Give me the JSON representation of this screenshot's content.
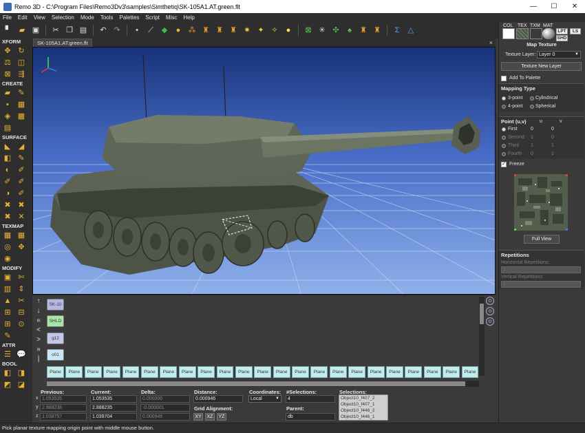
{
  "window": {
    "title": "Remo 3D - C:\\Program Files\\Remo3Dv3\\samples\\Simthetiq\\SK-105A1.AT.green.flt",
    "minimize": "—",
    "maximize": "☐",
    "close": "✕"
  },
  "menu": [
    "File",
    "Edit",
    "View",
    "Selection",
    "Mode",
    "Tools",
    "Palettes",
    "Script",
    "Misc",
    "Help"
  ],
  "toolbar_icons": [
    {
      "name": "new-icon",
      "glyph": "▘",
      "color": "#e8e8e8"
    },
    {
      "name": "open-icon",
      "glyph": "▰",
      "color": "#e8c048"
    },
    {
      "name": "save-icon",
      "glyph": "▣",
      "color": "#dddddd"
    },
    {
      "name": "cut-icon",
      "glyph": "✂",
      "color": "#dddddd"
    },
    {
      "name": "copy-icon",
      "glyph": "❐",
      "color": "#dddddd"
    },
    {
      "name": "paste-icon",
      "glyph": "▤",
      "color": "#dddddd"
    },
    {
      "name": "undo-icon",
      "glyph": "↶",
      "color": "#dddddd"
    },
    {
      "name": "redo-icon",
      "glyph": "↷",
      "color": "#9a9a9a"
    },
    {
      "name": "select-vertex-icon",
      "glyph": "•",
      "color": "#dddddd"
    },
    {
      "name": "select-edge-icon",
      "glyph": "⟋",
      "color": "#dddddd"
    },
    {
      "name": "select-face-icon",
      "glyph": "◆",
      "color": "#44b84a"
    },
    {
      "name": "select-object-icon",
      "glyph": "●",
      "color": "#e8b030"
    },
    {
      "name": "select-group-icon",
      "glyph": "⁂",
      "color": "#e89030"
    },
    {
      "name": "hierarchy-icon",
      "glyph": "♜",
      "color": "#e89030"
    },
    {
      "name": "lod-icon",
      "glyph": "♜",
      "color": "#e8a030"
    },
    {
      "name": "switch-icon",
      "glyph": "♜",
      "color": "#e8a030"
    },
    {
      "name": "light-point-icon",
      "glyph": "✷",
      "color": "#f0d040"
    },
    {
      "name": "light-points-icon",
      "glyph": "✦",
      "color": "#f0d040"
    },
    {
      "name": "light-string-icon",
      "glyph": "✧",
      "color": "#f0d040"
    },
    {
      "name": "light-source-icon",
      "glyph": "●",
      "color": "#f5e050"
    },
    {
      "name": "dof-icon",
      "glyph": "⊠",
      "color": "#5cc85c"
    },
    {
      "name": "clip-icon",
      "glyph": "✳",
      "color": "#dddddd"
    },
    {
      "name": "degree-of-freedom-icon",
      "glyph": "✣",
      "color": "#5cc85c"
    },
    {
      "name": "sound-icon",
      "glyph": "♠",
      "color": "#5cc85c"
    },
    {
      "name": "texture-mapping-icon",
      "glyph": "♜",
      "color": "#e8a030"
    },
    {
      "name": "transform-icon",
      "glyph": "♜",
      "color": "#e8a030"
    },
    {
      "name": "sum-icon",
      "glyph": "Σ",
      "color": "#58a0e8"
    },
    {
      "name": "triangle-icon",
      "glyph": "△",
      "color": "#58a0e8"
    }
  ],
  "left_tools": [
    {
      "label": "XFORM",
      "rows": [
        [
          "✥",
          "↻"
        ],
        [
          "⚖",
          "◫"
        ],
        [
          "⊠",
          "⇶"
        ]
      ]
    },
    {
      "label": "CREATE",
      "rows": [
        [
          "▰",
          "✎"
        ],
        [
          "▪",
          "▦"
        ],
        [
          "◈",
          "▩"
        ],
        [
          "▤",
          ""
        ]
      ]
    },
    {
      "label": "SURFACE",
      "rows": [
        [
          "◣",
          "◢"
        ],
        [
          "◧",
          "✎"
        ],
        [
          "◐",
          "✐"
        ],
        [
          "✐",
          "✐"
        ],
        [
          "◑",
          "✐"
        ],
        [
          "✖",
          "✖"
        ],
        [
          "✖",
          "✕"
        ]
      ]
    },
    {
      "label": "TEXMAP",
      "rows": [
        [
          "▦",
          "▦"
        ],
        [
          "◎",
          "✥"
        ],
        [
          "◉",
          ""
        ]
      ]
    },
    {
      "label": "MODIFY",
      "rows": [
        [
          "▣",
          "✄"
        ],
        [
          "▥",
          "⇕"
        ],
        [
          "▲",
          "✂"
        ],
        [
          "⊞",
          "⊟"
        ],
        [
          "⊞",
          "⊙"
        ],
        [
          "✎",
          ""
        ]
      ]
    },
    {
      "label": "ATTR",
      "rows": [
        [
          "☰",
          "💬"
        ]
      ]
    },
    {
      "label": "BOOL",
      "rows": [
        [
          "◧",
          "◨"
        ],
        [
          "◩",
          "◪"
        ]
      ]
    }
  ],
  "document_tab": "SK-105A1.AT.green.flt",
  "document_tab_close": "×",
  "viewport": {
    "axis_x_color": "#e63c3c",
    "axis_y_color": "#3c78e6",
    "axis_z_color": "#3ce63c"
  },
  "scenegraph": {
    "arrows": [
      "↑",
      "↓",
      "«",
      "<",
      ">",
      "»",
      "|"
    ],
    "nodes": [
      {
        "label": "SK-10",
        "color": "#b7b7e6"
      },
      {
        "label": "SHLD",
        "color": "#a7e5a7"
      },
      {
        "label": "g12",
        "color": "#c5c5ea"
      },
      {
        "label": "o01",
        "color": "#c8e8f8"
      }
    ],
    "leaves": [
      "Plane",
      "Plane",
      "Plane",
      "Plane",
      "Plane",
      "Plane",
      "Plane",
      "Plane",
      "Plane",
      "Plane",
      "Plane",
      "Plane",
      "Plane",
      "Plane",
      "Plane",
      "Plane",
      "Plane",
      "Plane",
      "Plane",
      "Plane",
      "Plane",
      "Plane",
      "Plane"
    ],
    "side_buttons": [
      "⊙",
      "⊙",
      "⊙"
    ]
  },
  "info": {
    "previous_label": "Previous:",
    "current_label": "Current:",
    "delta_label": "Delta:",
    "distance_label": "Distance:",
    "coordinates_label": "Coordinates:",
    "selections_count_label": "#Selections:",
    "selections_label": "Selections:",
    "grid_alignment_label": "Grid Alignment:",
    "parent_label": "Parent:",
    "axes": [
      "x",
      "y",
      "z"
    ],
    "previous": [
      "1.053535",
      "2.888236",
      "1.038757"
    ],
    "current": [
      "1.053535",
      "2.888235",
      "1.039704"
    ],
    "delta": [
      "0.000000",
      "-0.000001",
      "0.000946"
    ],
    "distance": "0.000946",
    "coordinates": "Local",
    "selections_count": "4",
    "parent": "db",
    "grid_buttons": [
      "XY",
      "XZ",
      "YZ"
    ],
    "selections": [
      "Object10_f407_2",
      "Object10_f407_1",
      "Object10_f446_2",
      "Object10_f446_1"
    ]
  },
  "status": "Pick planar texture mapping origin point with middle mouse button.",
  "right_panel": {
    "tabs": [
      "COL",
      "TEX",
      "TXM",
      "MAT"
    ],
    "small_buttons": [
      "LPT",
      "LS",
      "SHD"
    ],
    "title": "Map Texture",
    "texture_layer_label": "Texture Layer:",
    "texture_layer_value": "Layer 0",
    "texture_new_layer": "Texture New Layer",
    "add_to_palette": "Add To Palette",
    "mapping_type_title": "Mapping Type",
    "mapping_types": [
      "3-point",
      "Cylindrical",
      "4-point",
      "Spherical"
    ],
    "point_title": "Point (u,v)",
    "u_label": "u",
    "v_label": "v",
    "points": [
      {
        "name": "First",
        "u": "0",
        "v": "0",
        "active": true
      },
      {
        "name": "Second",
        "u": "1",
        "v": "0",
        "active": false
      },
      {
        "name": "Third",
        "u": "1",
        "v": "1",
        "active": false
      },
      {
        "name": "Fourth",
        "u": "0",
        "v": "1",
        "active": false
      }
    ],
    "freeze": "Freeze",
    "full_view": "Full View",
    "repetitions_title": "Repetitions",
    "horizontal_label": "Horizontal Repetitions:",
    "horizontal_value": "1",
    "vertical_label": "Vertical Repetitions:",
    "vertical_value": "1"
  }
}
